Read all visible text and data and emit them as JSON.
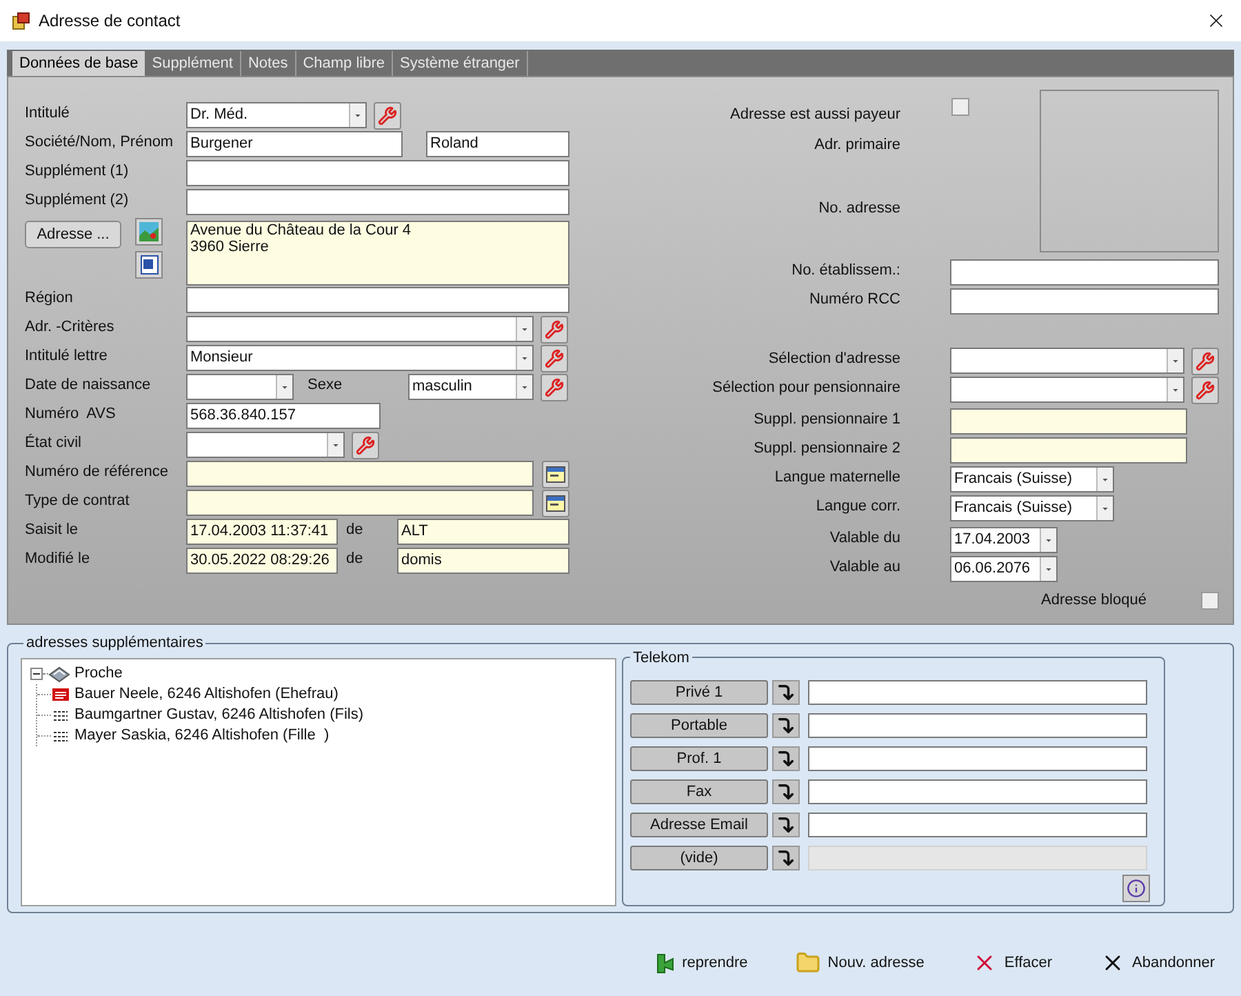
{
  "window": {
    "title": "Adresse de contact"
  },
  "tabs": [
    {
      "label": "Données de base",
      "selected": true
    },
    {
      "label": "Supplément",
      "selected": false
    },
    {
      "label": "Notes",
      "selected": false
    },
    {
      "label": "Champ libre",
      "selected": false
    },
    {
      "label": "Système étranger",
      "selected": false
    }
  ],
  "base": {
    "intitule": {
      "label": "Intitulé",
      "value": "Dr. Méd."
    },
    "nom": {
      "label": "Société/Nom, Prénom",
      "last_name": "Burgener",
      "first_name": "Roland"
    },
    "supplement_1": {
      "label": "Supplément (1)"
    },
    "supplement_2": {
      "label": "Supplément (2)"
    },
    "address": {
      "button": "Adresse ...",
      "lines": [
        "Avenue du Château de la Cour 4",
        "3960 Sierre"
      ]
    },
    "region": {
      "label": "Région"
    },
    "criteres": {
      "label": "Adr. -Critères"
    },
    "intitule_lettre": {
      "label": "Intitulé lettre",
      "value": "Monsieur"
    },
    "naissance": {
      "label": "Date de naissance"
    },
    "sexe": {
      "label": "Sexe",
      "value": "masculin"
    },
    "avs": {
      "label": "Numéro  AVS",
      "value": "568.36.840.157"
    },
    "etat_civil": {
      "label": "État civil"
    },
    "reference": {
      "label": "Numéro de référence"
    },
    "contrat": {
      "label": "Type de contrat"
    },
    "saisit": {
      "label": "Saisit le",
      "date": "17.04.2003 11:37:41",
      "by_label": "de",
      "by": "ALT"
    },
    "modifie": {
      "label": "Modifié le",
      "date": "30.05.2022 08:29:26",
      "by_label": "de",
      "by": "domis"
    }
  },
  "right": {
    "payeur": {
      "label": "Adresse est aussi payeur",
      "checked": false
    },
    "adr_primaire": {
      "label": "Adr. primaire"
    },
    "no_adresse": {
      "label": "No. adresse"
    },
    "etablissement": {
      "label": "No. établissem.:"
    },
    "rcc": {
      "label": "Numéro RCC"
    },
    "selection": {
      "label": "Sélection d'adresse"
    },
    "pension": {
      "label": "Sélection pour pensionnaire"
    },
    "suppl_1": {
      "label": "Suppl. pensionnaire 1"
    },
    "suppl_2": {
      "label": "Suppl. pensionnaire 2"
    },
    "langue_maternelle": {
      "label": "Langue maternelle",
      "value": "Francais (Suisse)"
    },
    "langue_corr": {
      "label": "Langue corr.",
      "value": "Francais (Suisse)"
    },
    "valable_du": {
      "label": "Valable du",
      "value": "17.04.2003"
    },
    "valable_au": {
      "label": "Valable au",
      "value": "06.06.2076"
    },
    "bloque": {
      "label": "Adresse bloqué",
      "checked": false
    }
  },
  "additional": {
    "title": "adresses supplémentaires",
    "tree": [
      {
        "label": "Proche",
        "expanded": true,
        "children": [
          {
            "label": "Bauer Neele, 6246 Altishofen (Ehefrau)",
            "kind": "marked"
          },
          {
            "label": "Baumgartner Gustav, 6246 Altishofen (Fils)",
            "kind": "plain"
          },
          {
            "label": "Mayer Saskia, 6246 Altishofen (Fille  )",
            "kind": "plain"
          }
        ]
      }
    ]
  },
  "telekom": {
    "title": "Telekom",
    "rows": [
      {
        "label": "Privé 1",
        "disabled": false
      },
      {
        "label": "Portable",
        "disabled": false
      },
      {
        "label": "Prof. 1",
        "disabled": false
      },
      {
        "label": "Fax",
        "disabled": false
      },
      {
        "label": "Adresse Email",
        "disabled": false
      },
      {
        "label": "(vide)",
        "disabled": true
      }
    ]
  },
  "actions": [
    {
      "label": "reprendre",
      "kind": "apply"
    },
    {
      "label": "Nouv. adresse",
      "kind": "new"
    },
    {
      "label": "Effacer",
      "kind": "delete"
    },
    {
      "label": "Abandonner",
      "kind": "cancel"
    }
  ]
}
